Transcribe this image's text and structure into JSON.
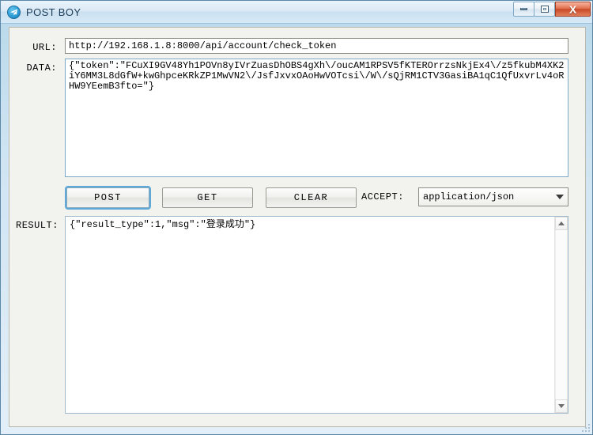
{
  "window": {
    "title": "POST BOY",
    "icon": "paper-plane-icon",
    "controls": {
      "minimize": "–",
      "maximize": "□",
      "close": "X"
    },
    "frame_color": "#5b87a8",
    "titlebar_color": "#d7e9f7"
  },
  "form": {
    "url": {
      "label": "URL:",
      "value": "http://192.168.1.8:8000/api/account/check_token",
      "placeholder": ""
    },
    "data": {
      "label": "DATA:",
      "value": "{\"token\":\"FCuXI9GV48Yh1POVn8yIVrZuasDhOBS4gXh\\/oucAM1RPSV5fKTEROrrzsNkjEx4\\/z5fkubM4XK2iY6MM3L8dGfW+kwGhpceKRkZP1MwVN2\\/JsfJxvxOAoHwVOTcsi\\/W\\/sQjRM1CTV3GasiBA1qC1QfUxvrLv4oRHW9YEemB3fto=\"}",
      "placeholder": ""
    },
    "result": {
      "label": "RESULT:",
      "value": "{\"result_type\":1,\"msg\":\"登录成功\"}"
    }
  },
  "actions": {
    "post_label": "POST",
    "get_label": "GET",
    "clear_label": "CLEAR",
    "focused_button": "POST",
    "focus_color": "#5ea9d8"
  },
  "accept": {
    "label": "ACCEPT:",
    "selected": "application/json",
    "options": [
      "application/json"
    ]
  },
  "scrollbar": {
    "up_arrow": "▲",
    "down_arrow": "▼"
  }
}
